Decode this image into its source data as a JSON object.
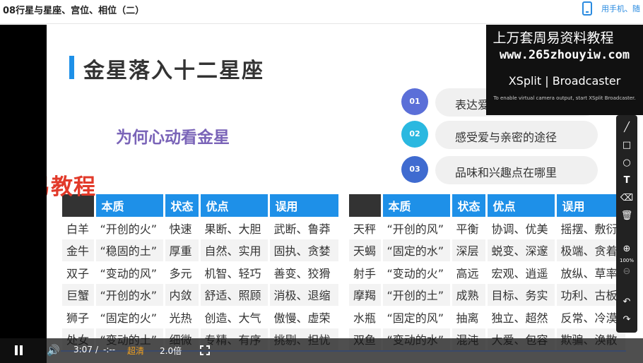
{
  "header": {
    "title": "08行星与星座、宫位、相位（二）",
    "mobile_link": "用手机、随"
  },
  "slide": {
    "title": "金星落入十二星座",
    "question": "为何心动看金星",
    "points": [
      {
        "num": "01",
        "text": "表达爱",
        "color": "#5b6fd8"
      },
      {
        "num": "02",
        "text": "感受爱与亲密的途径",
        "color": "#2ab8e0"
      },
      {
        "num": "03",
        "text": "品味和兴趣点在哪里",
        "color": "#3f6bd0"
      }
    ],
    "headers": [
      "",
      "本质",
      "状态",
      "优点",
      "误用"
    ],
    "left_rows": [
      [
        "白羊",
        "“开创的火”",
        "快速",
        "果断、大胆",
        "武断、鲁莽"
      ],
      [
        "金牛",
        "“稳固的土”",
        "厚重",
        "自然、实用",
        "固执、贪婪"
      ],
      [
        "双子",
        "“变动的风”",
        "多元",
        "机智、轻巧",
        "善变、狡猾"
      ],
      [
        "巨蟹",
        "“开创的水”",
        "内敛",
        "舒适、照顾",
        "消极、退缩"
      ],
      [
        "狮子",
        "“固定的火”",
        "光热",
        "创造、大气",
        "傲慢、虚荣"
      ],
      [
        "处女",
        "“变动的土”",
        "细微",
        "专精、有序",
        "挑剔、担忧"
      ]
    ],
    "right_rows": [
      [
        "天秤",
        "“开创的风”",
        "平衡",
        "协调、优美",
        "摇摆、敷衍"
      ],
      [
        "天蝎",
        "“固定的水”",
        "深层",
        "蜕变、深邃",
        "极端、贪着"
      ],
      [
        "射手",
        "“变动的火”",
        "高远",
        "宏观、逍遥",
        "放纵、草率"
      ],
      [
        "摩羯",
        "“开创的土”",
        "成熟",
        "目标、务实",
        "功利、古板"
      ],
      [
        "水瓶",
        "“固定的风”",
        "抽离",
        "独立、超然",
        "反常、冷漠"
      ],
      [
        "双鱼",
        "“变动的水”",
        "混沌",
        "大爱、包容",
        "欺骗、涣散"
      ]
    ]
  },
  "watermarks": {
    "red": "九易教程",
    "overlay_cn": "上万套周易资料教程",
    "overlay_url": "www.265zhouyiw.com",
    "xsplit_brand": "XSplit | Broadcaster",
    "xsplit_note": "To enable virtual camera output, start XSplit Broadcaster."
  },
  "toolbox": {
    "zoom_level": "100%",
    "icons": [
      "line-icon",
      "rectangle-icon",
      "circle-icon",
      "text-icon",
      "eraser-icon",
      "trash-icon",
      "zoom-in-icon",
      "zoom-out-icon",
      "undo-icon",
      "redo-icon"
    ]
  },
  "controls": {
    "time_current": "3:07",
    "time_sep": "/",
    "time_total": "-:--",
    "quality": "超清",
    "speed": "2.0倍",
    "quality_color": "#f0a020"
  }
}
